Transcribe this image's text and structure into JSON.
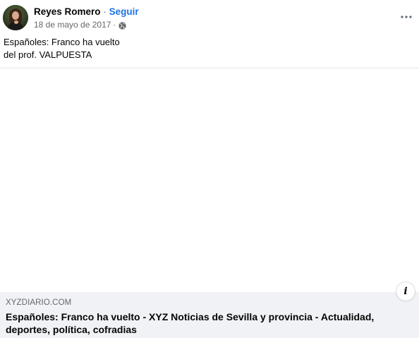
{
  "post": {
    "author": "Reyes Romero",
    "separator": "·",
    "follow_label": "Seguir",
    "date": "18 de mayo de 2017",
    "meta_separator": "·",
    "audience_icon": "globe-icon",
    "more_icon": "more-horizontal-icon",
    "text_lines": [
      "Españoles: Franco ha vuelto",
      "del prof. VALPUESTA"
    ]
  },
  "link_preview": {
    "domain": "XYZDIARIO.COM",
    "title": "Españoles: Franco ha vuelto - XYZ Noticias de Sevilla y provincia - Actualidad, deportes, política, cofradias",
    "info_label": "i"
  },
  "colors": {
    "link_blue": "#1b74e4",
    "secondary_text": "#65676b",
    "card_background": "#f0f2f5",
    "divider": "#e4e6eb"
  }
}
